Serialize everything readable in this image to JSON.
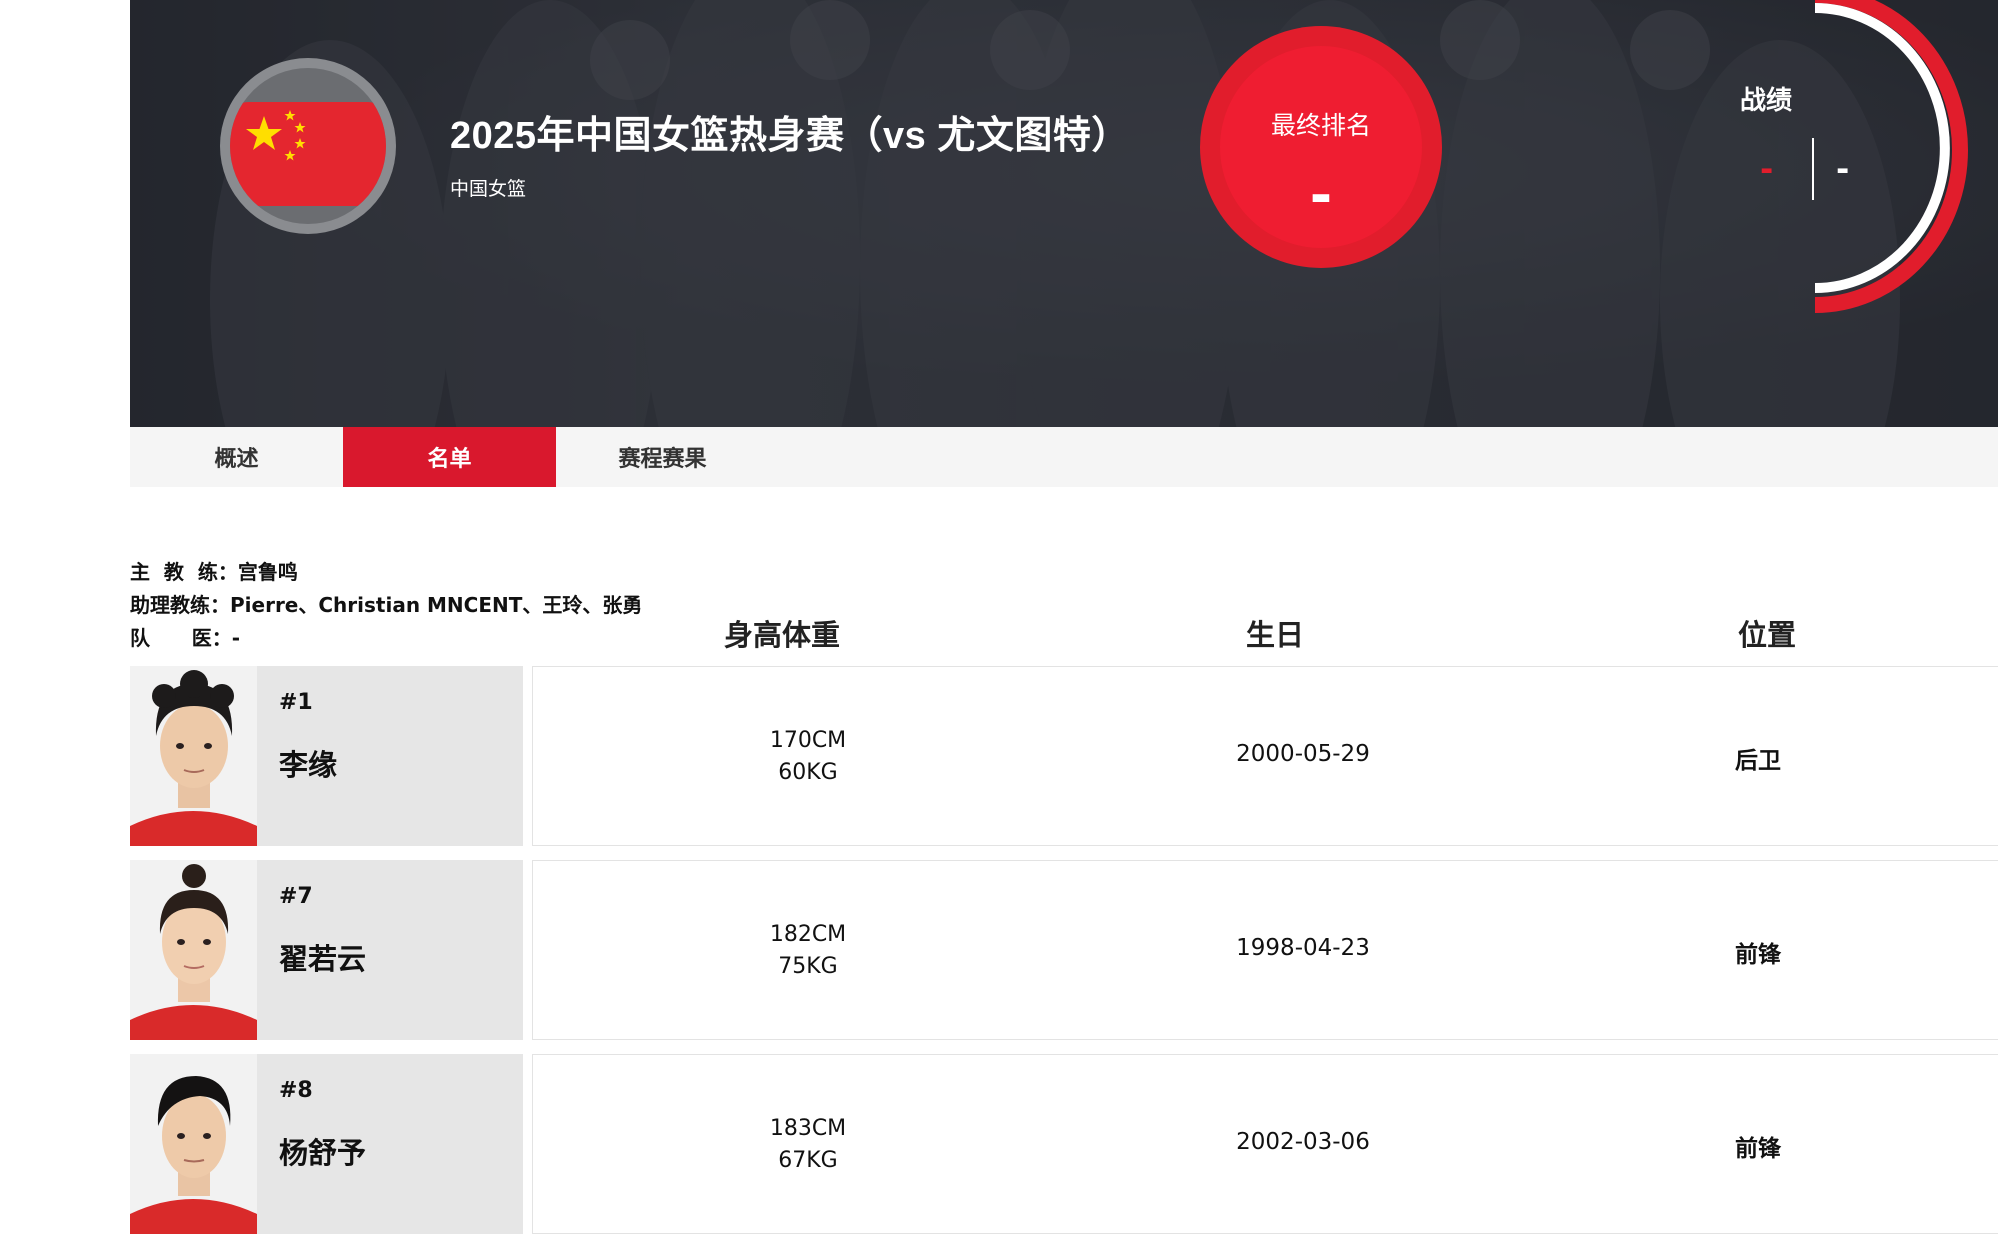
{
  "hero": {
    "title": "2025年中国女篮热身赛（vs 尤文图特）",
    "subtitle": "中国女篮",
    "rank_label": "最终排名",
    "rank_value": "-",
    "record_label": "战绩",
    "record_wins": "-",
    "record_losses": "-"
  },
  "tabs": [
    {
      "label": "概述"
    },
    {
      "label": "名单"
    },
    {
      "label": "赛程赛果"
    }
  ],
  "staff": {
    "head_coach_label": "主  教  练：",
    "head_coach": "宫鲁鸣",
    "assistant_label": "助理教练：",
    "assistants": "Pierre、Christian MNCENT、王玲、张勇",
    "doctor_label": "队      医：",
    "doctor": "-"
  },
  "columns": {
    "height_weight": "身高体重",
    "birthday": "生日",
    "position": "位置"
  },
  "players": [
    {
      "number": "#1",
      "name": "李缘",
      "height": "170CM",
      "weight": "60KG",
      "birthday": "2000-05-29",
      "position": "后卫"
    },
    {
      "number": "#7",
      "name": "翟若云",
      "height": "182CM",
      "weight": "75KG",
      "birthday": "1998-04-23",
      "position": "前锋"
    },
    {
      "number": "#8",
      "name": "杨舒予",
      "height": "183CM",
      "weight": "67KG",
      "birthday": "2002-03-06",
      "position": "前锋"
    }
  ],
  "colors": {
    "accent": "#d9182d",
    "hero_bg": "#2f3239",
    "tab_bg": "#f5f5f5"
  }
}
